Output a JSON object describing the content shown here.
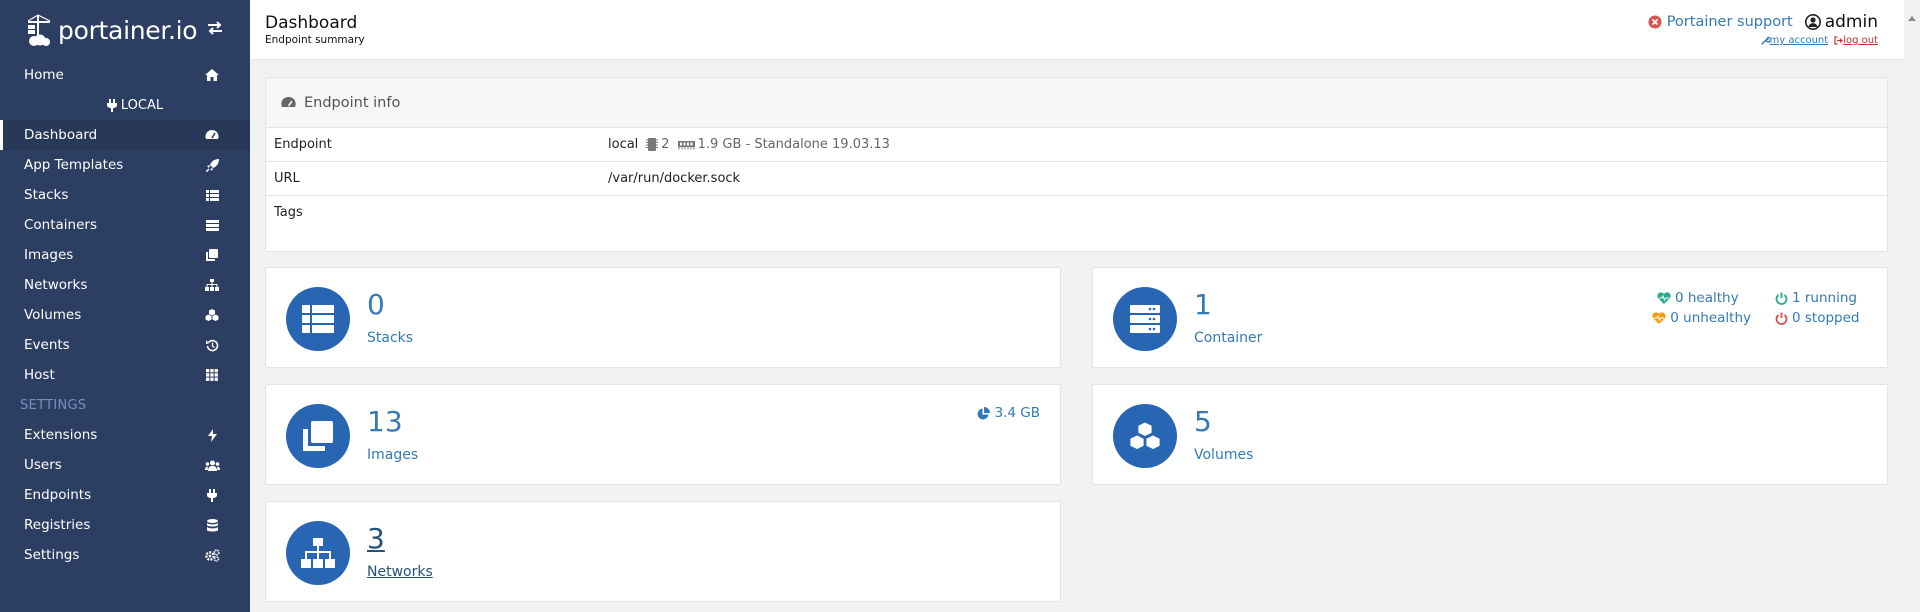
{
  "brand": {
    "name": "portainer.io"
  },
  "sidebar": {
    "items": [
      {
        "label": "Home",
        "icon": "home-icon"
      },
      {
        "label": "App Templates",
        "icon": "rocket-icon"
      },
      {
        "label": "Stacks",
        "icon": "th-list-icon"
      },
      {
        "label": "Containers",
        "icon": "server-icon"
      },
      {
        "label": "Images",
        "icon": "clone-icon"
      },
      {
        "label": "Networks",
        "icon": "sitemap-icon"
      },
      {
        "label": "Volumes",
        "icon": "cubes-icon"
      },
      {
        "label": "Events",
        "icon": "history-icon"
      },
      {
        "label": "Host",
        "icon": "th-icon"
      }
    ],
    "endpoint_name": "LOCAL",
    "dashboard_label": "Dashboard",
    "settings_heading": "SETTINGS",
    "settings_items": [
      {
        "label": "Extensions",
        "icon": "bolt-icon"
      },
      {
        "label": "Users",
        "icon": "users-icon"
      },
      {
        "label": "Endpoints",
        "icon": "plug-icon"
      },
      {
        "label": "Registries",
        "icon": "database-icon"
      },
      {
        "label": "Settings",
        "icon": "cogs-icon"
      }
    ]
  },
  "header": {
    "title": "Dashboard",
    "subtitle": "Endpoint summary",
    "support_label": "Portainer support",
    "username": "admin",
    "my_account_label": "my account",
    "log_out_label": "log out"
  },
  "endpoint_info": {
    "title": "Endpoint info",
    "rows": [
      {
        "key": "Endpoint",
        "value": "local",
        "cpu": "2",
        "memory": "1.9 GB - Standalone 19.03.13"
      },
      {
        "key": "URL",
        "value": "/var/run/docker.sock"
      },
      {
        "key": "Tags",
        "value": ""
      }
    ]
  },
  "tiles": {
    "stacks": {
      "count": "0",
      "label": "Stacks"
    },
    "containers": {
      "count": "1",
      "label": "Container",
      "healthy": "0 healthy",
      "running": "1 running",
      "unhealthy": "0 unhealthy",
      "stopped": "0 stopped"
    },
    "images": {
      "count": "13",
      "label": "Images",
      "size": "3.4 GB"
    },
    "volumes": {
      "count": "5",
      "label": "Volumes"
    },
    "networks": {
      "count": "3",
      "label": "Networks"
    }
  },
  "colors": {
    "sidebar_bg": "#2d3e63",
    "accent": "#337ab7",
    "tile_icon_bg": "#2866b4",
    "healthy": "#23ae89",
    "unhealthy": "#f39c12",
    "stopped": "#d9534f"
  }
}
